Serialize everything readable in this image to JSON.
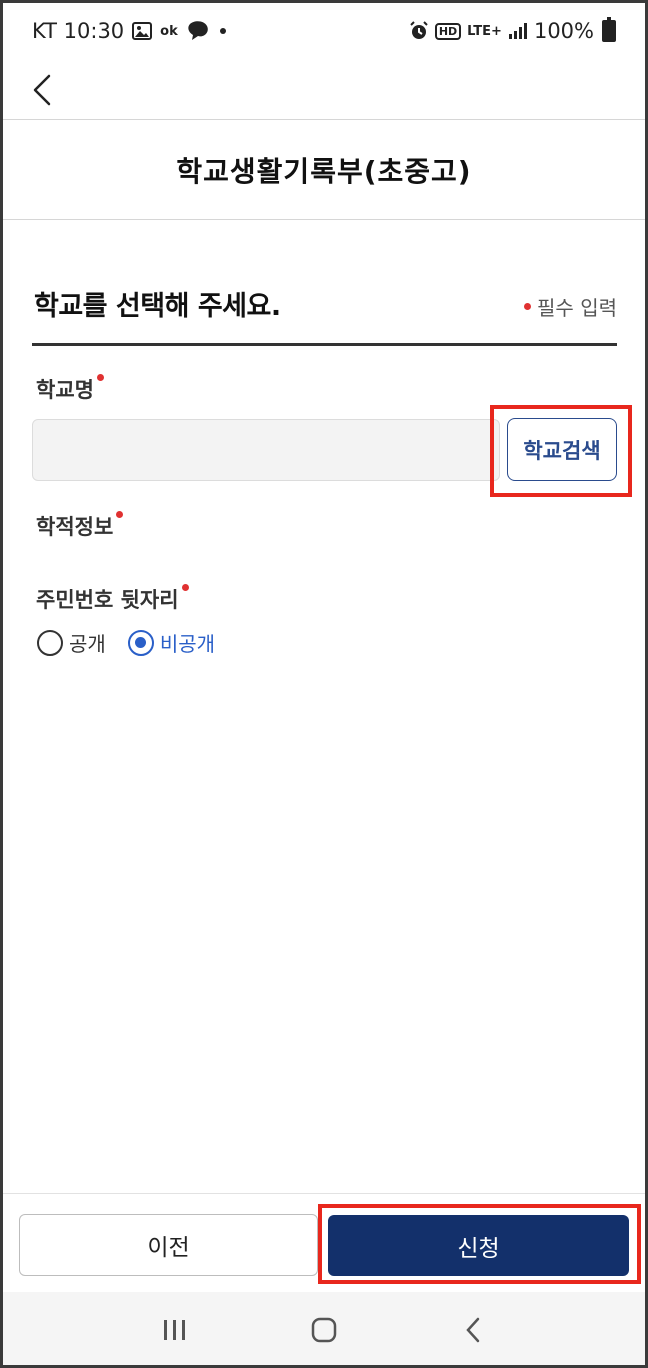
{
  "status_bar": {
    "carrier_time": "KT 10:30",
    "notification_icons": [
      "image-icon",
      "ok-cashbag-icon",
      "messenger-icon",
      "dot-icon"
    ],
    "right_icons": [
      "alarm-icon",
      "hd-icon",
      "lte-icon",
      "signal-icon"
    ],
    "battery_text": "100%",
    "hd_label": "HD",
    "lte_label": "LTE+",
    "ok_label": "ok"
  },
  "header": {
    "title": "학교생활기록부(초중고)"
  },
  "form": {
    "section_title": "학교를 선택해 주세요.",
    "required_note": "필수 입력",
    "school_name_label": "학교명",
    "school_name_value": "",
    "school_name_placeholder": "",
    "search_button": "학교검색",
    "academic_info_label": "학적정보",
    "resident_number_label": "주민번호 뒷자리",
    "radio_options": [
      {
        "label": "공개",
        "checked": false
      },
      {
        "label": "비공개",
        "checked": true
      }
    ]
  },
  "actions": {
    "prev_label": "이전",
    "apply_label": "신청"
  },
  "colors": {
    "primary": "#13306b",
    "accent_blue": "#2a5fc8",
    "required_red": "#e03131",
    "highlight_red": "#e8271d"
  }
}
